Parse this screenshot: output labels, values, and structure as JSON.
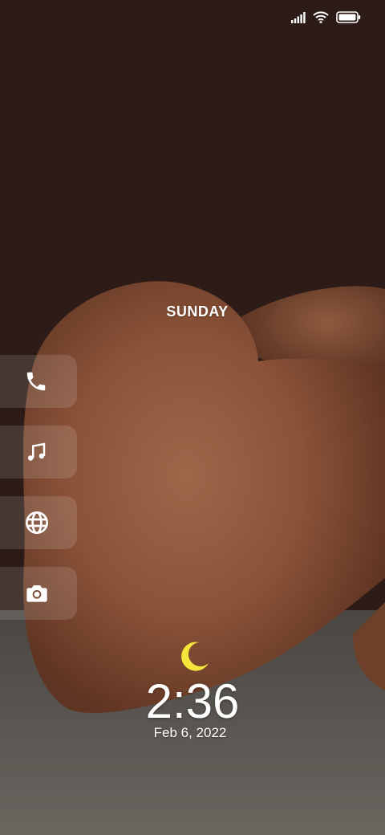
{
  "status_bar": {
    "icons": [
      "signal-icon",
      "wifi-icon",
      "battery-icon"
    ]
  },
  "lockscreen": {
    "day": "SUNDAY",
    "time": "2:36",
    "date": "Feb 6, 2022",
    "weather_icon": "moon-icon"
  },
  "shortcuts": [
    {
      "name": "phone",
      "icon": "phone-icon"
    },
    {
      "name": "music",
      "icon": "music-note-icon"
    },
    {
      "name": "browser",
      "icon": "globe-icon"
    },
    {
      "name": "camera",
      "icon": "camera-icon"
    }
  ],
  "colors": {
    "moon": "#f5e53a",
    "text": "#ffffff"
  }
}
